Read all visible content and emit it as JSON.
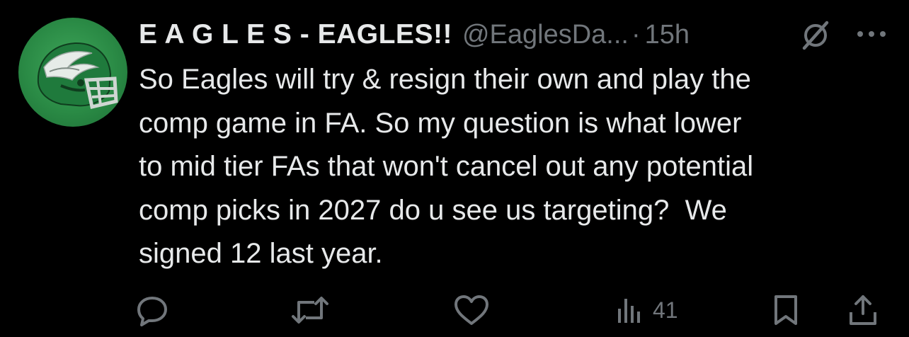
{
  "tweet": {
    "display_name": "E A G L E S - EAGLES!!",
    "handle": "@EaglesDa...",
    "separator": "·",
    "time": "15h",
    "text": "So Eagles will try & resign their own and play the\ncomp game in FA. So my question is what lower\nto mid tier FAs that won't cancel out any potential\ncomp picks in 2027 do u see us targeting?  We\nsigned 12 last year.",
    "views": "41"
  },
  "icons": {
    "avatar": "eagles-helmet-avatar",
    "grok": "grok-slash-icon",
    "more": "more-dots-icon",
    "reply": "reply-icon",
    "retweet": "retweet-icon",
    "like": "heart-icon",
    "views": "views-bar-chart-icon",
    "bookmark": "bookmark-icon",
    "share": "share-icon"
  },
  "colors": {
    "background": "#000000",
    "text_primary": "#e7e9ea",
    "text_secondary": "#71767b",
    "avatar_green": "#2a8a45"
  }
}
